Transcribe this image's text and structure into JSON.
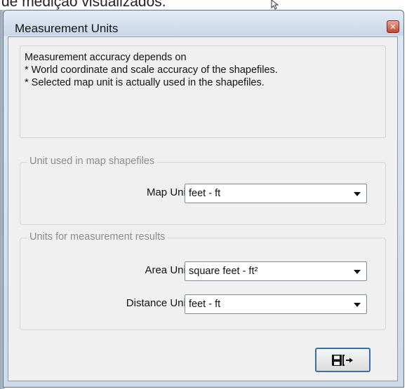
{
  "background": {
    "caption": "de medição visualizados."
  },
  "dialog": {
    "title": "Measurement Units",
    "close_icon": "close-icon",
    "info": {
      "line1": "Measurement accuracy depends on",
      "line2": "* World coordinate and scale accuracy of the shapefiles.",
      "line3": "* Selected map unit is actually used in the shapefiles."
    },
    "map_group": {
      "title": "Unit used in map shapefiles",
      "map_unit_label": "Map Unit",
      "map_unit_value": "feet - ft"
    },
    "results_group": {
      "title": "Units for measurement results",
      "area_unit_label": "Area Unit",
      "area_unit_value": "square feet - ft²",
      "distance_unit_label": "Distance Unit",
      "distance_unit_value": "feet - ft"
    },
    "save_button": {
      "icon": "save-exit-icon"
    }
  },
  "colors": {
    "accent": "#3b6ea8",
    "close": "#c4452e",
    "disabled_text": "#8c8c8c"
  }
}
